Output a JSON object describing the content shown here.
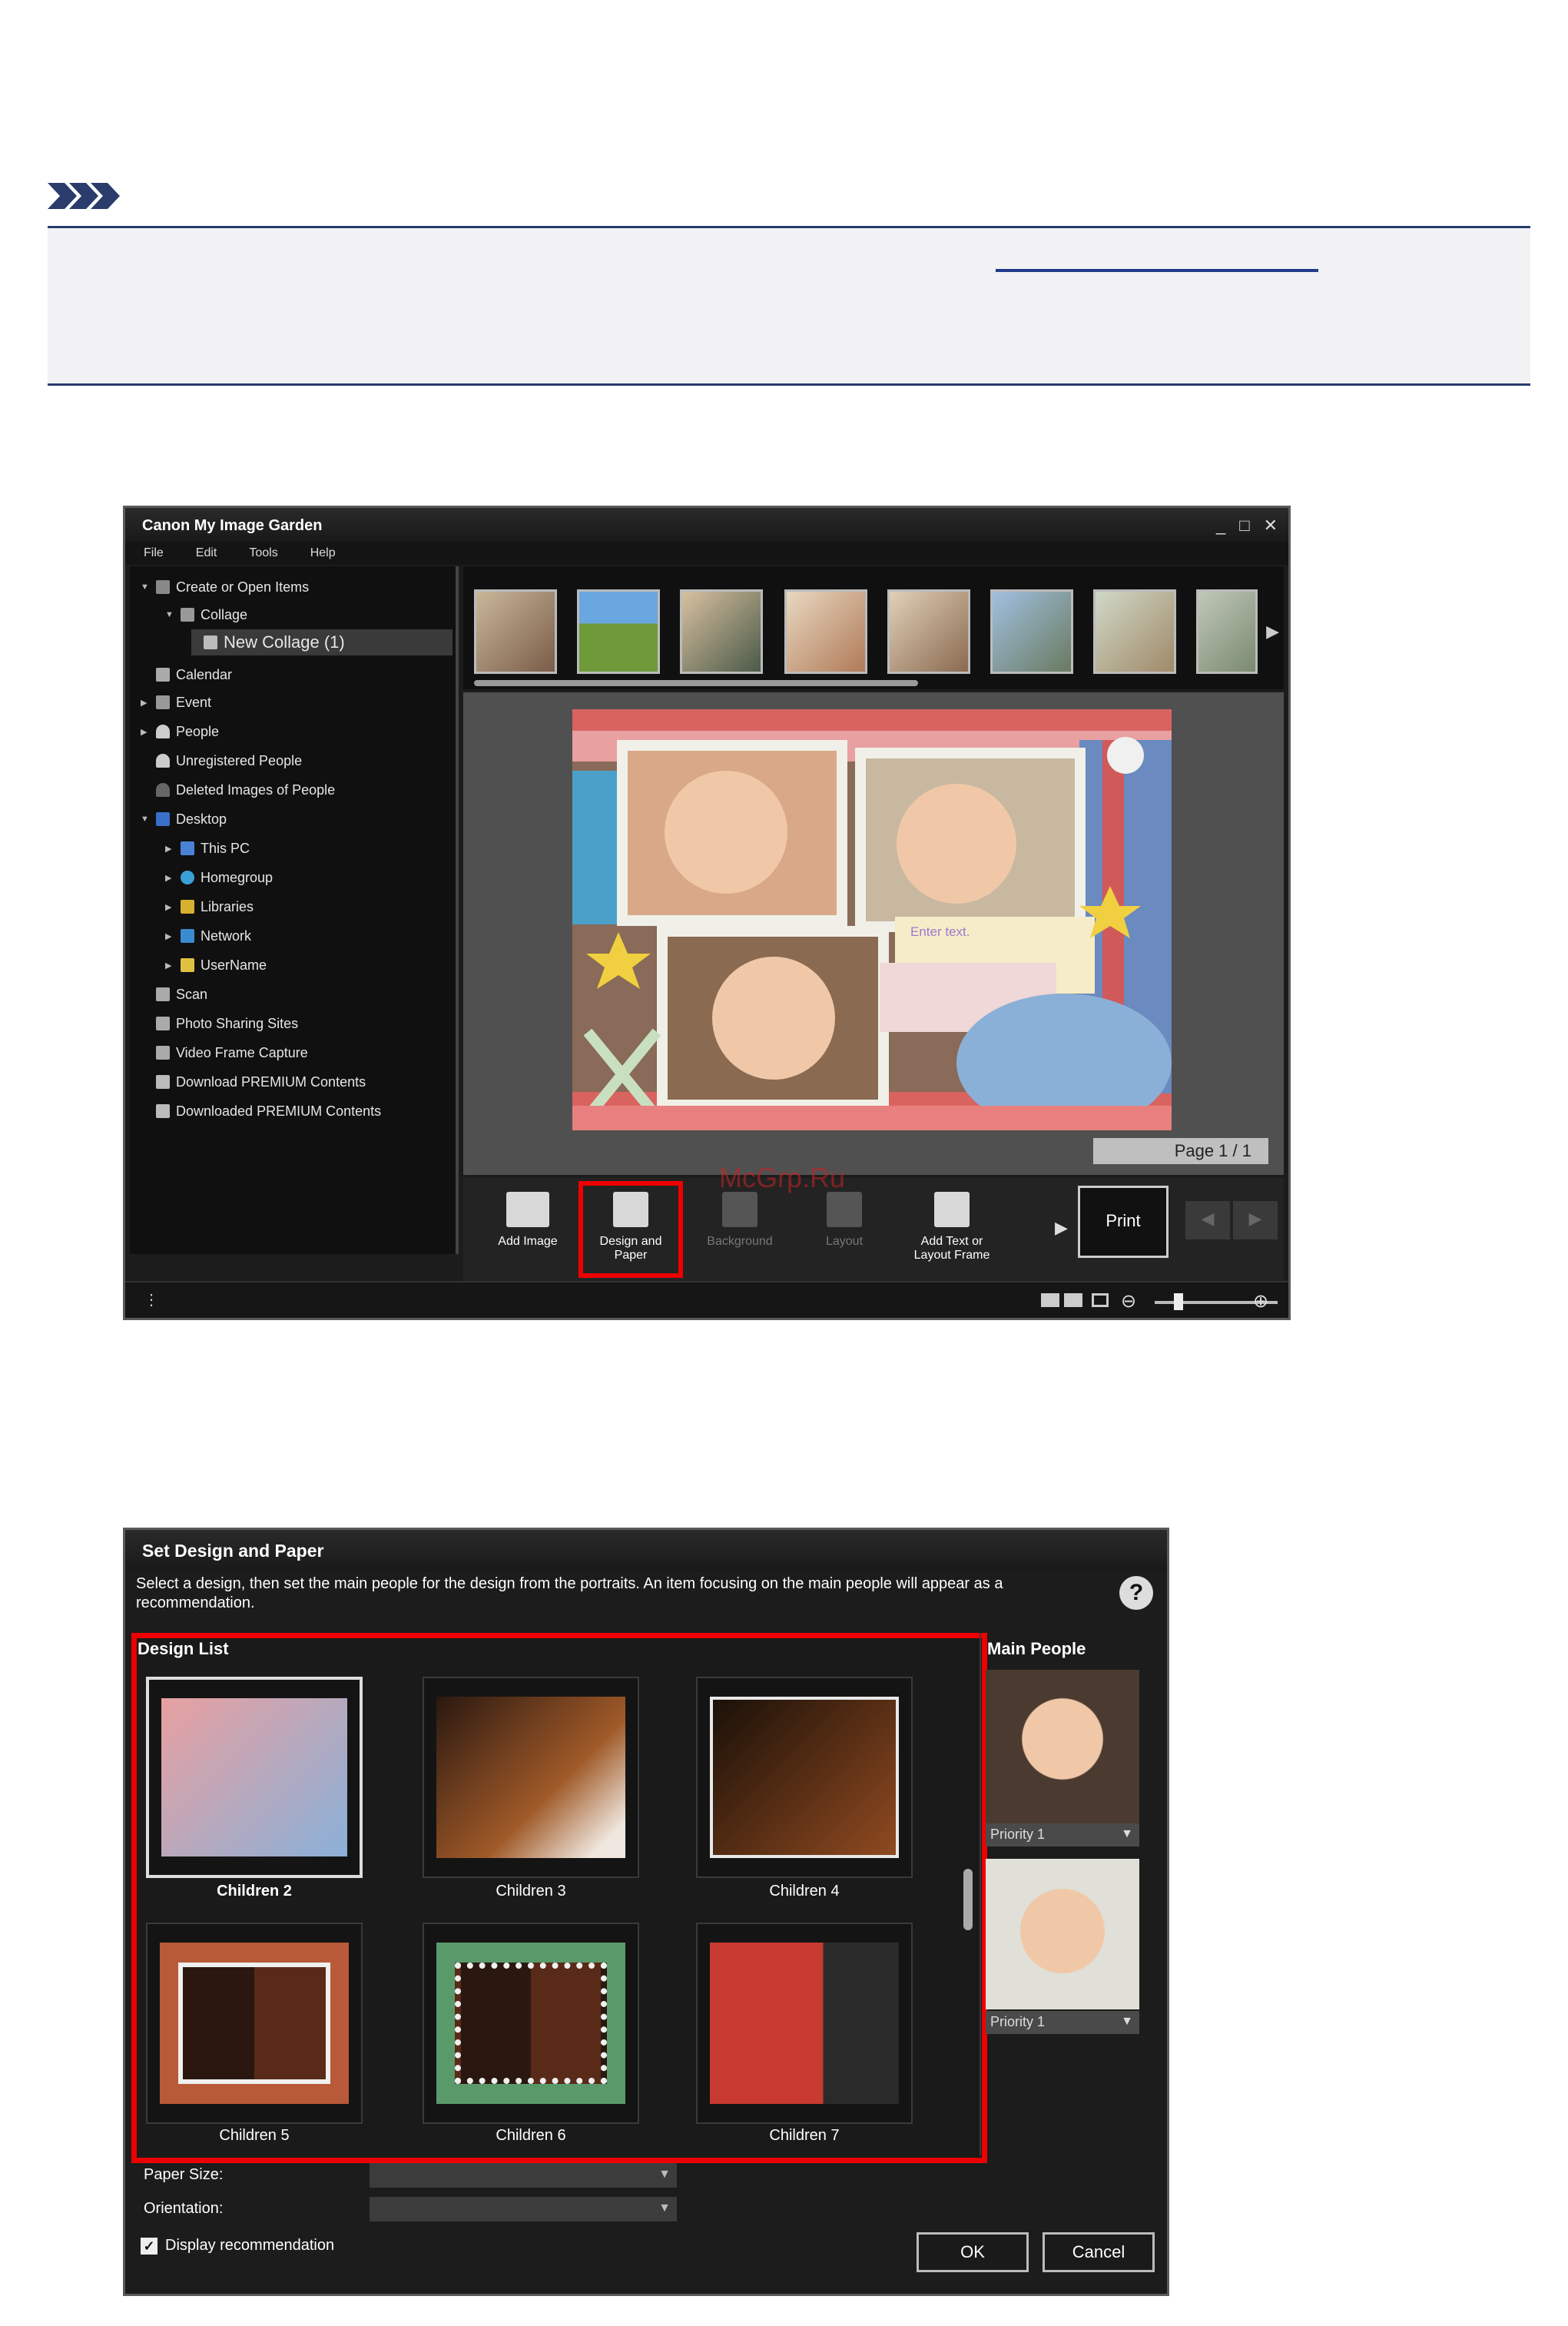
{
  "note": {
    "icon": "note-icon"
  },
  "window1": {
    "title": "Canon My Image Garden",
    "menu": [
      "File",
      "Edit",
      "Tools",
      "Help"
    ],
    "tree": [
      {
        "label": "Create or Open Items",
        "icon": "create-icon"
      },
      {
        "label": "Collage",
        "icon": "collage-icon"
      },
      {
        "label": "New Collage (1)",
        "icon": "collage-item-icon",
        "selected": true
      },
      {
        "label": "Calendar",
        "icon": "calendar-icon"
      },
      {
        "label": "Event",
        "icon": "event-icon"
      },
      {
        "label": "People",
        "icon": "people-icon"
      },
      {
        "label": "Unregistered People",
        "icon": "unregistered-people-icon"
      },
      {
        "label": "Deleted Images of People",
        "icon": "deleted-people-icon"
      },
      {
        "label": "Desktop",
        "icon": "desktop-icon"
      },
      {
        "label": "This PC",
        "icon": "this-pc-icon"
      },
      {
        "label": "Homegroup",
        "icon": "homegroup-icon"
      },
      {
        "label": "Libraries",
        "icon": "libraries-icon"
      },
      {
        "label": "Network",
        "icon": "network-icon"
      },
      {
        "label": "UserName",
        "icon": "user-folder-icon"
      },
      {
        "label": "Scan",
        "icon": "scan-icon"
      },
      {
        "label": "Photo Sharing Sites",
        "icon": "photo-sharing-icon"
      },
      {
        "label": "Video Frame Capture",
        "icon": "video-capture-icon"
      },
      {
        "label": "Download PREMIUM Contents",
        "icon": "download-premium-icon"
      },
      {
        "label": "Downloaded PREMIUM Contents",
        "icon": "downloaded-premium-icon"
      }
    ],
    "collage_text": {
      "enter_text": "Enter text."
    },
    "page_indicator": "Page 1 / 1",
    "toolbar": {
      "add_image": "Add Image",
      "design_and_paper": "Design and Paper",
      "background": "Background",
      "layout": "Layout",
      "add_text": "Add Text or Layout Frame",
      "print": "Print"
    },
    "watermark": "McGrp.Ru"
  },
  "window2": {
    "title": "Set Design and Paper",
    "instruction": "Select a design, then set the main people for the design from the portraits. An item focusing on the main people will appear as a recommendation.",
    "design_list_title": "Design List",
    "designs": [
      "Children 2",
      "Children 3",
      "Children 4",
      "Children 5",
      "Children 6",
      "Children 7"
    ],
    "selected_design": "Children 2",
    "main_people_title": "Main People",
    "people": [
      {
        "priority": "Priority 1"
      },
      {
        "priority": "Priority 1"
      }
    ],
    "paper_size_label": "Paper Size:",
    "orientation_label": "Orientation:",
    "display_recommendation": "Display recommendation",
    "display_recommendation_checked": true,
    "ok": "OK",
    "cancel": "Cancel"
  },
  "colors": {
    "highlight": "#e00000",
    "note_border": "#2a3c6c",
    "collage_bg": "#d9635f"
  }
}
